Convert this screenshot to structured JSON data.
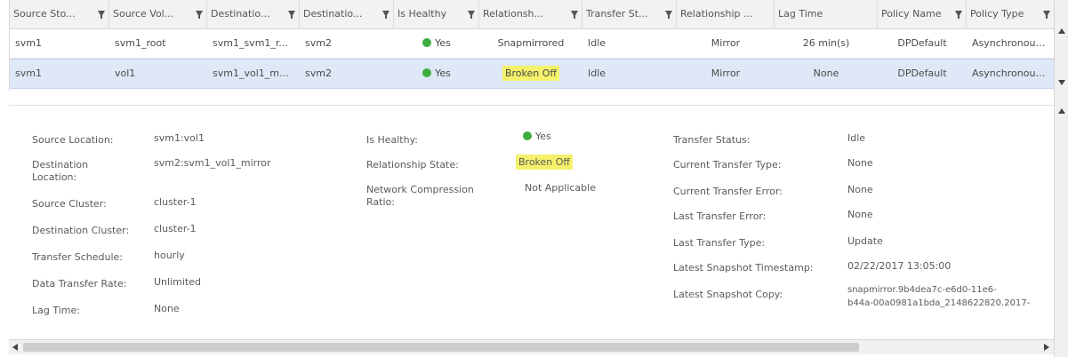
{
  "columns": [
    {
      "label": "Source Sto...",
      "filter": true
    },
    {
      "label": "Source Vol...",
      "filter": true
    },
    {
      "label": "Destinatio...",
      "filter": true
    },
    {
      "label": "Destinatio...",
      "filter": true
    },
    {
      "label": "Is Healthy",
      "filter": true
    },
    {
      "label": "Relationsh...",
      "filter": true
    },
    {
      "label": "Transfer St...",
      "filter": true
    },
    {
      "label": "Relationship ...",
      "filter": false
    },
    {
      "label": "Lag Time",
      "filter": false
    },
    {
      "label": "Policy Name",
      "filter": true
    },
    {
      "label": "Policy Type",
      "filter": true
    }
  ],
  "rows": [
    {
      "source_svm": "svm1",
      "source_vol": "svm1_root",
      "dest_vol": "svm1_svm1_r...",
      "dest_svm": "svm2",
      "healthy": "Yes",
      "state": "Snapmirrored",
      "transfer_status": "Idle",
      "rel_type": "Mirror",
      "lag": "26 min(s)",
      "policy": "DPDefault",
      "policy_type": "Asynchronous..."
    },
    {
      "source_svm": "svm1",
      "source_vol": "vol1",
      "dest_vol": "svm1_vol1_m...",
      "dest_svm": "svm2",
      "healthy": "Yes",
      "state": "Broken Off",
      "transfer_status": "Idle",
      "rel_type": "Mirror",
      "lag": "None",
      "policy": "DPDefault",
      "policy_type": "Asynchronous..."
    }
  ],
  "details": {
    "col1": {
      "source_location_label": "Source Location:",
      "source_location": "svm1:vol1",
      "destination_location_label_1": "Destination",
      "destination_location_label_2": "Location:",
      "destination_location": "svm2:svm1_vol1_mirror",
      "source_cluster_label": "Source Cluster:",
      "source_cluster": "cluster-1",
      "destination_cluster_label": "Destination Cluster:",
      "destination_cluster": "cluster-1",
      "transfer_schedule_label": "Transfer Schedule:",
      "transfer_schedule": "hourly",
      "data_transfer_rate_label": "Data Transfer Rate:",
      "data_transfer_rate": "Unlimited",
      "lag_time_label": "Lag Time:",
      "lag_time": "None"
    },
    "col2": {
      "is_healthy_label": "Is Healthy:",
      "is_healthy": "Yes",
      "relationship_state_label": "Relationship State:",
      "relationship_state": "Broken Off",
      "network_compression_label_1": "Network Compression",
      "network_compression_label_2": "Ratio:",
      "network_compression": "Not Applicable"
    },
    "col3": {
      "transfer_status_label": "Transfer Status:",
      "transfer_status": "Idle",
      "current_transfer_type_label": "Current Transfer Type:",
      "current_transfer_type": "None",
      "current_transfer_error_label": "Current Transfer Error:",
      "current_transfer_error": "None",
      "last_transfer_error_label": "Last Transfer Error:",
      "last_transfer_error": "None",
      "last_transfer_type_label": "Last Transfer Type:",
      "last_transfer_type": "Update",
      "latest_snapshot_timestamp_label": "Latest Snapshot Timestamp:",
      "latest_snapshot_timestamp": "02/22/2017 13:05:00",
      "latest_snapshot_copy_label": "Latest Snapshot Copy:",
      "latest_snapshot_copy_1": "snapmirror.9b4dea7c-e6d0-11e6-",
      "latest_snapshot_copy_2": "b44a-00a0981a1bda_2148622820.2017-"
    }
  },
  "icons": {
    "healthy": "green-status-dot-icon",
    "filter": "funnel-filter-icon"
  },
  "colors": {
    "healthy_green": "#3fae3f",
    "highlight_yellow": "#f5f16a",
    "selected_row": "#dfe8f6"
  }
}
